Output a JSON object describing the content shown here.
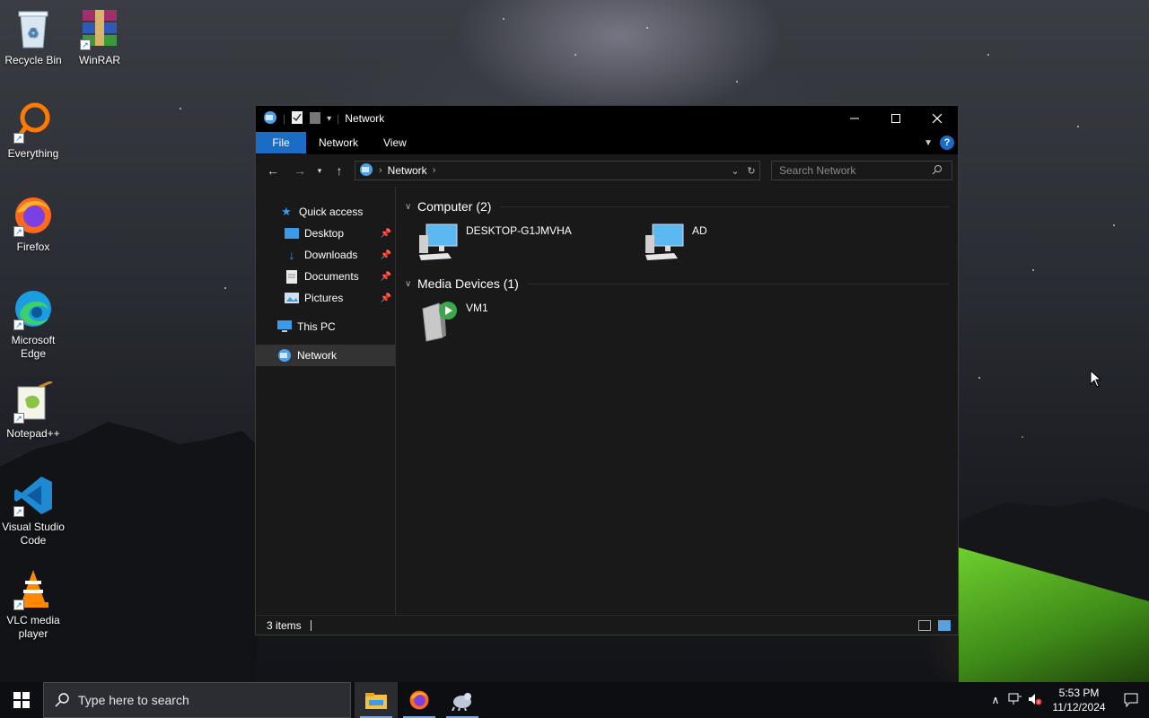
{
  "desktop": {
    "icons": [
      {
        "label": "Recycle Bin",
        "icon": "recycle-bin-icon"
      },
      {
        "label": "WinRAR",
        "icon": "winrar-icon"
      },
      {
        "label": "Everything",
        "icon": "everything-icon"
      },
      {
        "label": "Firefox",
        "icon": "firefox-icon"
      },
      {
        "label": "Microsoft Edge",
        "icon": "edge-icon"
      },
      {
        "label": "Notepad++",
        "icon": "notepadpp-icon"
      },
      {
        "label": "Visual Studio Code",
        "icon": "vscode-icon"
      },
      {
        "label": "VLC media player",
        "icon": "vlc-icon"
      }
    ]
  },
  "explorer": {
    "title": "Network",
    "ribbon_tabs": [
      "File",
      "Network",
      "View"
    ],
    "address": {
      "root": "Network"
    },
    "search_placeholder": "Search Network",
    "nav": {
      "quick_access": "Quick access",
      "items": [
        {
          "label": "Desktop",
          "pinned": true
        },
        {
          "label": "Downloads",
          "pinned": true
        },
        {
          "label": "Documents",
          "pinned": true
        },
        {
          "label": "Pictures",
          "pinned": true
        }
      ],
      "this_pc": "This PC",
      "network": "Network"
    },
    "groups": [
      {
        "header": "Computer (2)",
        "items": [
          "DESKTOP-G1JMVHA",
          "AD"
        ]
      },
      {
        "header": "Media Devices (1)",
        "items": [
          "VM1"
        ]
      }
    ],
    "status": "3 items"
  },
  "taskbar": {
    "search_placeholder": "Type here to search",
    "time": "5:53 PM",
    "date": "11/12/2024"
  },
  "colors": {
    "accent": "#1a6cc4",
    "window_bg": "#191919",
    "titlebar": "#000000"
  }
}
